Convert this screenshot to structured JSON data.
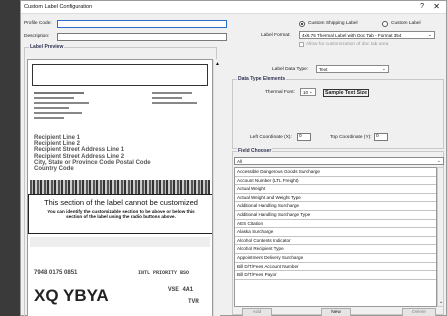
{
  "dialog": {
    "title": "Custom Label Configuration",
    "help": "?",
    "close": "✕"
  },
  "profile": {
    "code_label": "Profile Code:",
    "desc_label": "Description:",
    "code_value": "",
    "desc_value": ""
  },
  "preview": {
    "title": "Label Preview",
    "recipient": [
      "Recipient Line 1",
      "Recipient Line 2",
      "Recipient Street Address Line 1",
      "Recipient Street Address Line 2",
      "City, State or Province Code  Postal Code",
      "Country Code"
    ],
    "notice_title": "This section of the label cannot be customized",
    "notice_body": "You can identify the customizable section to be above or below this section of the label using the radio buttons above.",
    "tracking": "7948 0175 0851",
    "service": "INTL PRIORITY BSO",
    "big_code": "XQ YBYA",
    "ursa": "VSE 4A1",
    "tvr": "TVR"
  },
  "label_type": {
    "custom_shipping": "Custom Shipping Label",
    "custom_label": "Custom Label",
    "selected": "custom_shipping",
    "format_label": "Label Format:",
    "format_value": "4x6.75 Thermal Label with Doc Tab - Format 354",
    "allow_doc_tab": "Allow for customization of doc tab area"
  },
  "data_type": {
    "label": "Label Data Type:",
    "value": "Text"
  },
  "elements": {
    "title": "Data Type Elements",
    "font_label": "Thermal Font:",
    "font_value": "10",
    "sample": "Sample Text Size",
    "left_label": "Left Coordinate (X):",
    "left_value": "0",
    "top_label": "Top Coordinate (Y):",
    "top_value": "0"
  },
  "chooser": {
    "title": "Field Chooser",
    "filter": "All",
    "items": [
      "Accessible Dangerous Goods Surcharge",
      "Account Number (LTL Freight)",
      "Actual Weight",
      "Actual Weight and Weight Type",
      "Additional Handling Surcharge",
      "Additional Handling Surcharge Type",
      "AES Citation",
      "Alaska Surcharge",
      "Alcohol Contents Indicator",
      "Alcohol Recipient Type",
      "Appointment Delivery Surcharge",
      "Bill D/T/Fees Account Number",
      "Bill D/T/Fees Payor"
    ]
  },
  "buttons": {
    "add": "Add",
    "new": "New",
    "delete": "Delete"
  }
}
